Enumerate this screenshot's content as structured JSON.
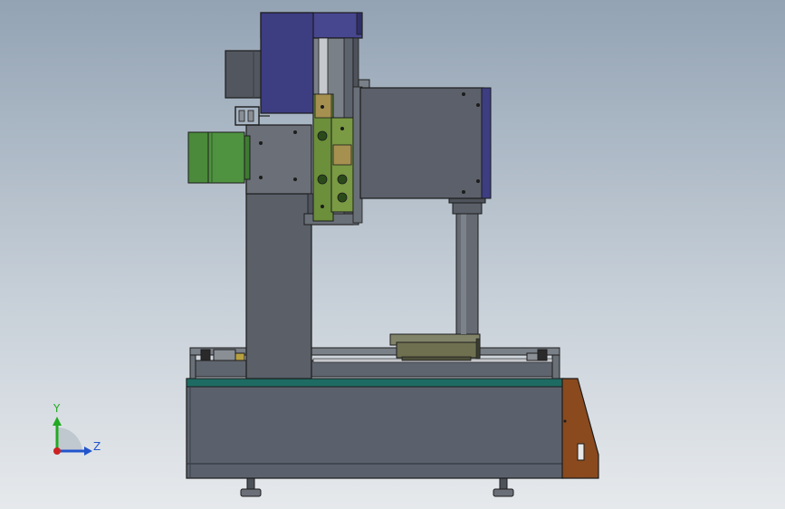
{
  "view": {
    "background_top": "#93a3b4",
    "background_bottom": "#e6e9ec"
  },
  "axis_triad": {
    "y_label": "Y",
    "z_label": "Z",
    "y_color": "#22aa22",
    "z_color": "#2255cc",
    "origin_color": "#cc2222"
  },
  "colors": {
    "base_body": "#5b616c",
    "teal_strip": "#1e6b63",
    "column": "#5a5f68",
    "motor_blue": "#3d3d82",
    "motor_green": "#4a8a3a",
    "brackets_green": "#6b8f3a",
    "side_panel": "#8a4a1e",
    "head_body": "#5b606a",
    "platform": "#6f7050"
  }
}
